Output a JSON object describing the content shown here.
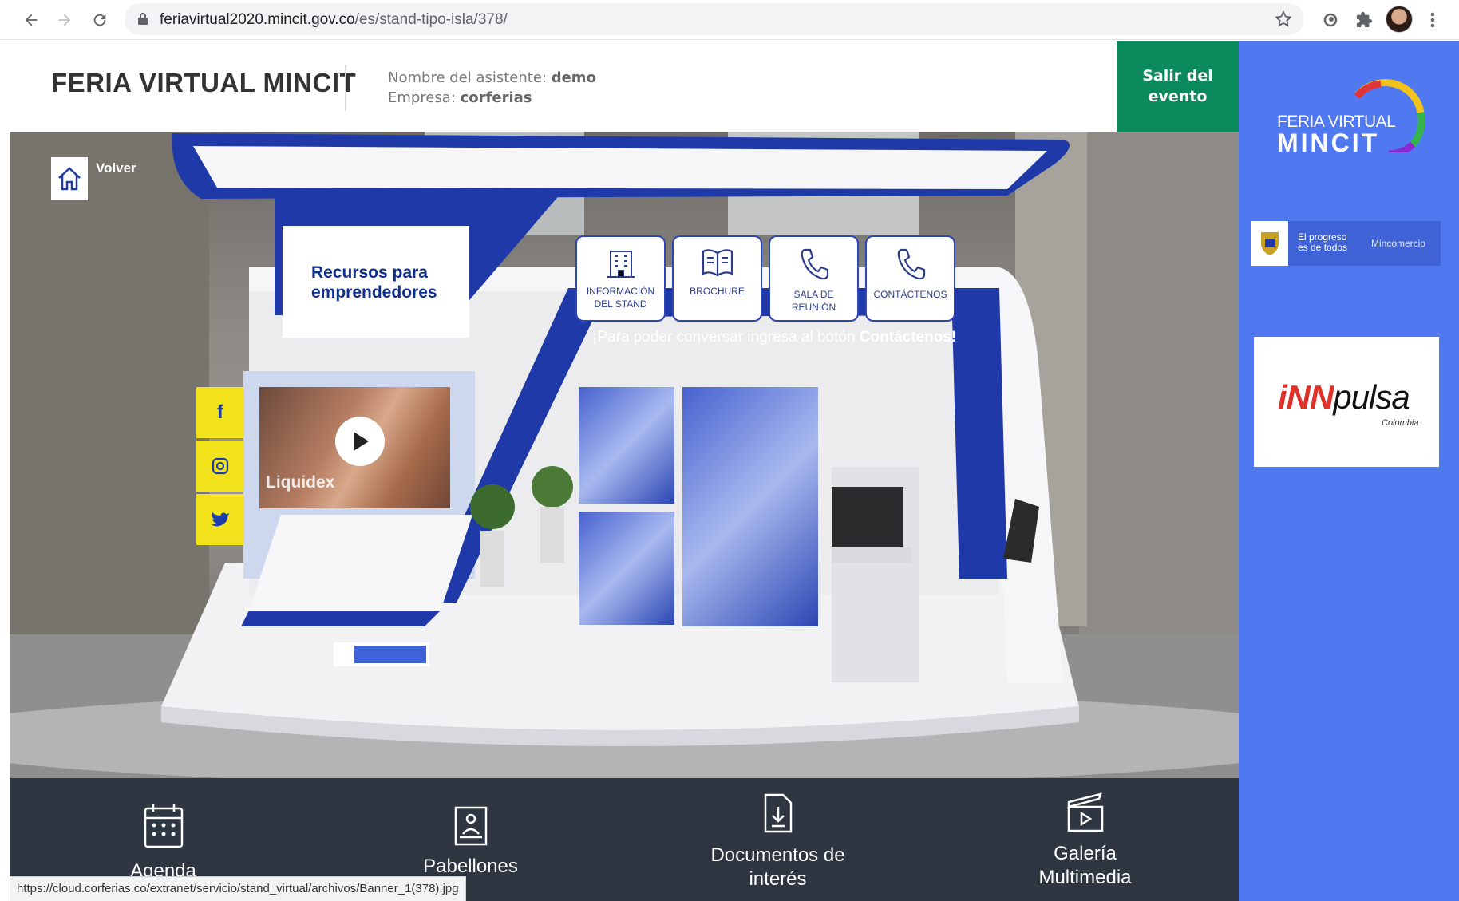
{
  "browser": {
    "url_domain": "feriavirtual2020.mincit.gov.co",
    "url_path": "/es/stand-tipo-isla/378/",
    "status_url": "https://cloud.corferias.co/extranet/servicio/stand_virtual/archivos/Banner_1(378).jpg"
  },
  "header": {
    "title": "FERIA VIRTUAL MINCIT",
    "attendee_label": "Nombre del asistente:",
    "attendee_name": "demo",
    "company_label": "Empresa:",
    "company_name": "corferias",
    "exit_label_1": "Salir del",
    "exit_label_2": "evento"
  },
  "sidebar": {
    "fv_line1": "FERIA VIRTUAL",
    "fv_line2": "MINCIT",
    "gov_line1": "El progreso",
    "gov_line2": "es de todos",
    "gov_ministry": "Mincomercio",
    "innpulsa_name_1": "iNN",
    "innpulsa_name_2": "pulsa",
    "innpulsa_country": "Colombia"
  },
  "stand": {
    "back_label": "Volver",
    "panel_line1": "Recursos para",
    "panel_line2": "emprendedores",
    "actions": [
      {
        "line1": "INFORMACIÓN",
        "line2": "DEL STAND"
      },
      {
        "line1": "BROCHURE",
        "line2": ""
      },
      {
        "line1": "SALA DE",
        "line2": "REUNIÓN"
      },
      {
        "line1": "CONTÁCTENOS",
        "line2": ""
      }
    ],
    "banner_text": "¡Para poder conversar ingresa al botón ",
    "banner_bold": "Contáctenos!",
    "video_label": "Liquidex",
    "social": [
      "f",
      "ig",
      "tw"
    ]
  },
  "bottom_nav": [
    {
      "line1": "Agenda",
      "line2": ""
    },
    {
      "line1": "Pabellones",
      "line2": ""
    },
    {
      "line1": "Documentos de",
      "line2": "interés"
    },
    {
      "line1": "Galería",
      "line2": "Multimedia"
    }
  ],
  "colors": {
    "brand_blue": "#1f3aa8",
    "side_blue": "#4f78f1",
    "exit_green": "#0a8a5a",
    "footer": "#2d3641",
    "social_yellow": "#f2e21b"
  }
}
